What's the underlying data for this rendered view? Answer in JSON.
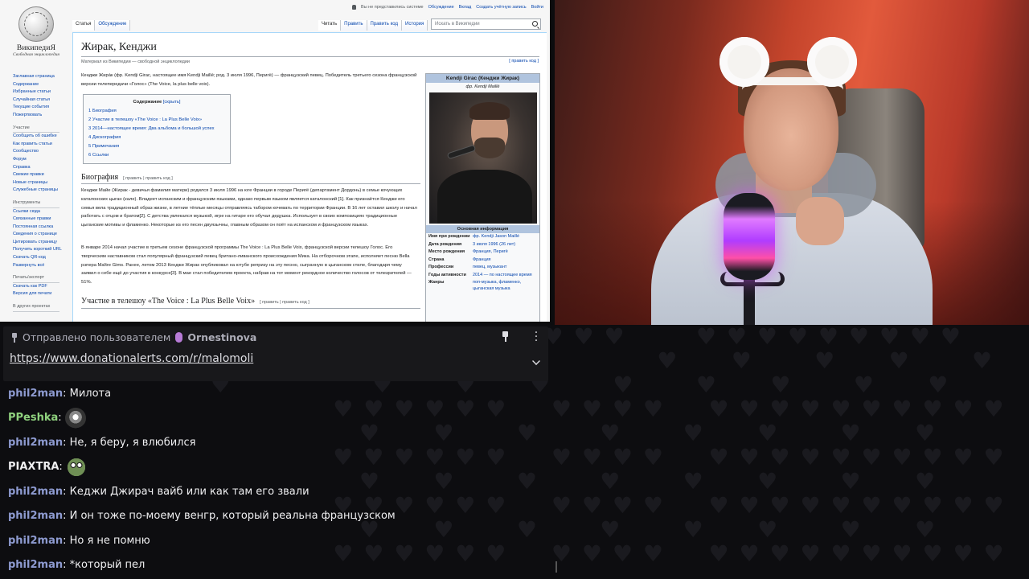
{
  "wiki": {
    "logo_name": "ВикипедиЯ",
    "logo_tagline": "Свободная энциклопедия",
    "personal": [
      "Вы не представились системе",
      "Обсуждение",
      "Вклад",
      "Создать учётную запись",
      "Войти"
    ],
    "tabs_left": [
      "Статья",
      "Обсуждение"
    ],
    "tabs_right": [
      "Читать",
      "Править",
      "Править код",
      "История"
    ],
    "search_placeholder": "Искать в Википедии",
    "sidebar_nav": [
      "Заглавная страница",
      "Содержание",
      "Избранные статьи",
      "Случайная статья",
      "Текущие события",
      "Пожертвовать"
    ],
    "sidebar_participation_title": "Участие",
    "sidebar_participation": [
      "Сообщить об ошибке",
      "Как править статьи",
      "Сообщество",
      "Форум",
      "Справка",
      "Свежие правки",
      "Новые страницы",
      "Служебные страницы"
    ],
    "sidebar_tools_title": "Инструменты",
    "sidebar_tools": [
      "Ссылки сюда",
      "Связанные правки",
      "Постоянная ссылка",
      "Сведения о странице",
      "Цитировать страницу",
      "Получить короткий URL",
      "Скачать QR-код",
      "Развернуть всё"
    ],
    "sidebar_print_title": "Печать/экспорт",
    "sidebar_print": [
      "Скачать как PDF",
      "Версия для печати"
    ],
    "sidebar_other_title": "В других проектах",
    "title": "Жирак, Кенджи",
    "from": "Материал из Википедии — свободной энциклопедии",
    "edit_code": "[ править код ]",
    "lead": "Кенджи Жира́к (фр. Kendji Girac, настоящее имя Kendji Maillé; род. 3 июля 1996, Перигё) — французский певец. Победитель третьего сезона французской версии телепередачи «Голос» (The Voice, la plus belle voix).",
    "toc_title": "Содержание",
    "toc_hide": "[скрыть]",
    "toc": [
      "1 Биография",
      "2 Участие в телешоу «The Voice : La Plus Belle Voix»",
      "3 2014—настоящее время: Два альбома и большой успех",
      "4 Дискография",
      "5 Примечания",
      "6 Ссылки"
    ],
    "h2_bio": "Биография",
    "h2_edit": "[ править | править код ]",
    "bio1": "Кенджи Майе (Жирак - девичья фамилия матери) родился 3 июля 1996 на юге Франции в городе Перигё (департамент Дордонь) в семье кочующих каталонских цыган (кале). Владеет испанским и французским языками, однако первым языком является каталонский [1]. Как признаётся Кенджи его семья вела традиционный образ жизни, в летние тёплые месяцы отправляясь табором кочевать по территории Франции. В 16 лет оставил школу и начал работать с отцом и братом[2]. С детства увлекался музыкой, игре на гитаре его обучал дедушка. Использует в своих композициях традиционные цыганские мотивы и фламенко. Некоторые из его песен двуязычны, главным образом он поёт на испанском и французском языках.",
    "bio2": "В январе 2014 начал участие в третьем сезоне французской программы The Voice : La Plus Belle Voix, французской версии телешоу Голос. Его творческим наставником стал популярный французский певец британо-ливанского происхождения Мика. На отборочном этапе, исполняет песню Bella рэпера Maître Gims. Ранее, летом 2013 Кенджи Жирак опубликовал на ютубе репризу на эту песню, сыгранную в цыганском стиле, благодаря чему заявил о себе ещё до участия в конкурсе[3]. В мае стал победителем проекта, набрав на тот момент рекордное количество голосов от телезрителей — 51%.",
    "h2_voice": "Участие в телешоу «The Voice : La Plus Belle Voix»",
    "h2_voice_edit": "[ править | править код ]",
    "infobox": {
      "title": "Kendji Girac (Кенджи Жирак)",
      "subtitle": "фр. Kendji Maillé",
      "section": "Основная информация",
      "rows": [
        {
          "k": "Имя при рождении",
          "v": "фр. Kendji Jason Maillé"
        },
        {
          "k": "Дата рождения",
          "v": "3 июля 1996 (26 лет)"
        },
        {
          "k": "Место рождения",
          "v": "Франция, Перигё"
        },
        {
          "k": "Страна",
          "v": "Франция"
        },
        {
          "k": "Профессии",
          "v": "певец, музыкант"
        },
        {
          "k": "Годы активности",
          "v": "2014 — по настоящее время"
        },
        {
          "k": "Жанры",
          "v": "поп-музыка, фламенко, цыганская музыка"
        }
      ]
    }
  },
  "pinned": {
    "header_prefix": "Отправлено пользователем",
    "username": "Ornestinova",
    "link": "https://www.donationalerts.com/r/malomoli"
  },
  "messages": [
    {
      "user": "phil2man",
      "color": "#8e9bd1",
      "text": ": Милота"
    },
    {
      "user": "PPeshka",
      "color": "#8fd17e",
      "text": ":",
      "emote": "cat"
    },
    {
      "user": "phil2man",
      "color": "#8e9bd1",
      "text": ": Не, я беру, я влюбился"
    },
    {
      "user": "PIAXTRA",
      "color": "#efeff1",
      "text": ":",
      "emote": "frog"
    },
    {
      "user": "phil2man",
      "color": "#8e9bd1",
      "text": ": Кеджи Джирач вайб или как там его звали"
    },
    {
      "user": "phil2man",
      "color": "#8e9bd1",
      "text": ": И он тоже по-моему венгр, который реальна французском"
    },
    {
      "user": "phil2man",
      "color": "#8e9bd1",
      "text": ": Но я не помню"
    },
    {
      "user": "phil2man",
      "color": "#8e9bd1",
      "text": ": *который пел"
    }
  ]
}
